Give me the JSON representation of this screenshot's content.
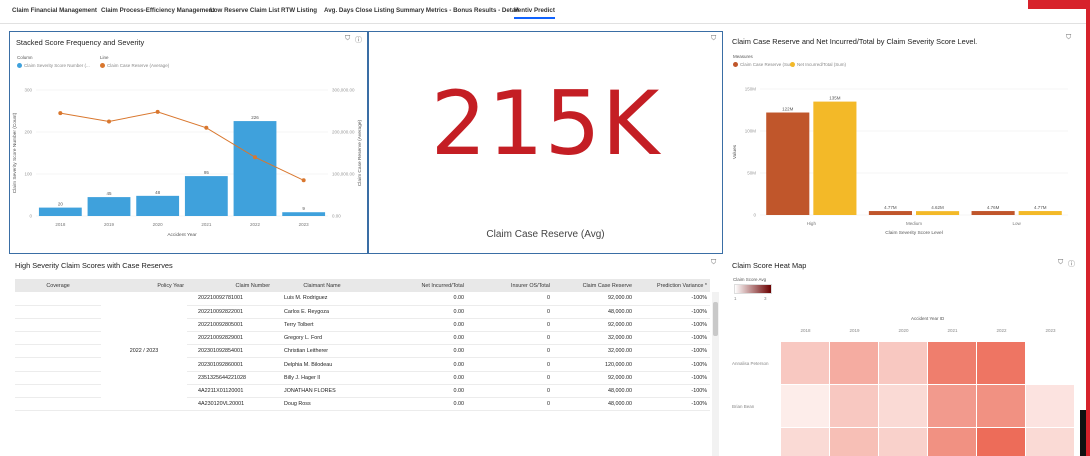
{
  "tabs": [
    {
      "label": "Claim Financial Management"
    },
    {
      "label": "Claim Process-Efficiency Management"
    },
    {
      "label": "Low Reserve Claim List"
    },
    {
      "label": "RTW Listing"
    },
    {
      "label": "Avg. Days Close Listing"
    },
    {
      "label": "Summary Metrics - Bonus Results - Detail"
    },
    {
      "label": "Ventiv Predict"
    }
  ],
  "panels": {
    "freq": {
      "title": "Stacked Score Frequency and Severity",
      "legend_column_head": "Column",
      "legend_column_item": "Claim Severity Score Number (...",
      "legend_line_head": "Line",
      "legend_line_item": "Claim Case Reserve (Average)"
    },
    "kpi": {
      "value": "215K",
      "label": "Claim Case Reserve (Avg)"
    },
    "reserve": {
      "title": "Claim Case Reserve and Net Incurred/Total by Claim Severity Score Level.",
      "legend_head": "Measures",
      "legend_item_1": "Claim Case Reserve (Sum)",
      "legend_item_2": "Net Incurred/Total (Sum)"
    },
    "table": {
      "title": "High Severity Claim Scores with Case Reserves"
    },
    "heatmap": {
      "title": "Claim Score Heat Map",
      "legend_label": "Claim Score Avg",
      "legend_min": "1",
      "legend_max": "3",
      "xaxis_title": "Accident Year ID",
      "years": [
        "2018",
        "2019",
        "2020",
        "2021",
        "2022",
        "2023"
      ],
      "rows": [
        {
          "name": "Annalisa Peterson",
          "values": [
            0.3,
            0.45,
            0.3,
            0.7,
            0.75,
            0.0
          ]
        },
        {
          "name": "Brian Bean",
          "values": [
            0.1,
            0.3,
            0.2,
            0.55,
            0.6,
            0.15
          ]
        },
        {
          "name": "",
          "values": [
            0.2,
            0.35,
            0.25,
            0.6,
            0.8,
            0.2
          ]
        }
      ],
      "colors": {
        "low": "#ffffff",
        "high": "#e8472f"
      }
    }
  },
  "table": {
    "columns": [
      "Coverage",
      "Policy Year",
      "Claim Number",
      "Claimant Name",
      "Net Incurred/Total",
      "Insurer OS/Total",
      "Claim Case Reserve",
      "Prediction Variance *"
    ],
    "policy_year_group": "2022 / 2023",
    "rows": [
      {
        "claim": "202210092781001",
        "name": "Luis M. Rodriguez",
        "net": "0.00",
        "os": "0",
        "reserve": "92,000.00",
        "variance": "-100%"
      },
      {
        "claim": "202210092822001",
        "name": "Carlos E. Reygoza",
        "net": "0.00",
        "os": "0",
        "reserve": "48,000.00",
        "variance": "-100%"
      },
      {
        "claim": "202210092805001",
        "name": "Terry Tolbert",
        "net": "0.00",
        "os": "0",
        "reserve": "92,000.00",
        "variance": "-100%"
      },
      {
        "claim": "202210092829001",
        "name": "Gregory L. Ford",
        "net": "0.00",
        "os": "0",
        "reserve": "32,000.00",
        "variance": "-100%"
      },
      {
        "claim": "202301092854001",
        "name": "Christian Leitherer",
        "net": "0.00",
        "os": "0",
        "reserve": "32,000.00",
        "variance": "-100%"
      },
      {
        "claim": "202301092860001",
        "name": "Delphia M. Bilodeau",
        "net": "0.00",
        "os": "0",
        "reserve": "120,000.00",
        "variance": "-100%"
      },
      {
        "claim": "2351325644221028",
        "name": "Billy J. Hager II",
        "net": "0.00",
        "os": "0",
        "reserve": "92,000.00",
        "variance": "-100%"
      },
      {
        "claim": "4A2211X01120001",
        "name": "JONATHAN FLORES",
        "net": "0.00",
        "os": "0",
        "reserve": "48,000.00",
        "variance": "-100%"
      },
      {
        "claim": "4A230120VL20001",
        "name": "Doug Ross",
        "net": "0.00",
        "os": "0",
        "reserve": "48,000.00",
        "variance": "-100%"
      }
    ]
  },
  "chart_data": [
    {
      "type": "bar",
      "title": "Stacked Score Frequency and Severity",
      "xlabel": "Accident Year",
      "ylabel": "Claim Severity Score Number (Count)",
      "y2label": "Claim Case Reserve (Average)",
      "categories": [
        "2018",
        "2019",
        "2020",
        "2021",
        "2022",
        "2023"
      ],
      "series": [
        {
          "name": "Claim Severity Score Number (...",
          "kind": "bar",
          "values": [
            20,
            45,
            48,
            95,
            226,
            9
          ],
          "color": "#3fa1dc"
        },
        {
          "name": "Claim Case Reserve (Average)",
          "kind": "line",
          "values": [
            245000,
            225000,
            248000,
            210000,
            140000,
            85000
          ],
          "color": "#d9772e"
        }
      ],
      "ylim": [
        0,
        300
      ],
      "y_ticks": [
        "0",
        "100",
        "200",
        "300"
      ],
      "y2lim": [
        0,
        300000
      ],
      "y2_ticks": [
        "0.00",
        "100,000.00",
        "200,000.00",
        "300,000.00"
      ],
      "data_labels": [
        "20",
        "45",
        "48",
        "95",
        "226",
        "9"
      ]
    },
    {
      "type": "bar",
      "title": "Claim Case Reserve and Net Incurred/Total by Claim Severity Score Level.",
      "xlabel": "Claim Severity Score Level",
      "ylabel": "Values",
      "categories": [
        "High",
        "Medium",
        "Low"
      ],
      "series": [
        {
          "name": "Claim Case Reserve (Sum)",
          "values": [
            122,
            4.7,
            4.7
          ],
          "color": "#c0562b"
        },
        {
          "name": "Net Incurred/Total (Sum)",
          "values": [
            135,
            4.6,
            4.7
          ],
          "color": "#f3b928"
        }
      ],
      "ylim": [
        0,
        150
      ],
      "y_ticks": [
        "0",
        "50M",
        "100M",
        "150M"
      ],
      "data_labels": [
        [
          "122M",
          "135M"
        ],
        [
          "4.77M",
          "4.62M"
        ],
        [
          "4.76M",
          "4.77M"
        ]
      ]
    }
  ]
}
